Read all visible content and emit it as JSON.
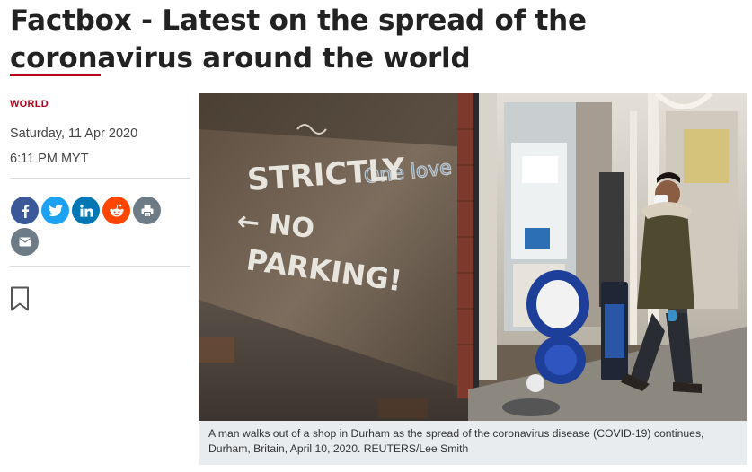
{
  "article": {
    "headline": "Factbox - Latest on the spread of the coronavirus around the world",
    "category": "WORLD",
    "date": "Saturday, 11 Apr 2020",
    "time": "6:11 PM MYT"
  },
  "share": {
    "buttons": [
      {
        "icon": "facebook-icon",
        "color": "#3b5998"
      },
      {
        "icon": "twitter-icon",
        "color": "#1da1f2"
      },
      {
        "icon": "linkedin-icon",
        "color": "#0077b5"
      },
      {
        "icon": "reddit-icon",
        "color": "#ff4500"
      },
      {
        "icon": "print-icon",
        "color": "#6d7b87"
      },
      {
        "icon": "email-icon",
        "color": "#6d7b87"
      }
    ]
  },
  "photo": {
    "graffiti": {
      "line1": "STRICTLY",
      "line2": "← NO",
      "line3": "PARKING!",
      "tag": "One love"
    },
    "caption": "A man walks out of a shop in Durham as the spread of the coronavirus disease (COVID-19) continues, Durham, Britain, April 10, 2020. REUTERS/Lee Smith"
  },
  "colors": {
    "accent": "#c0001b",
    "caption_bg": "#e9ecef"
  }
}
